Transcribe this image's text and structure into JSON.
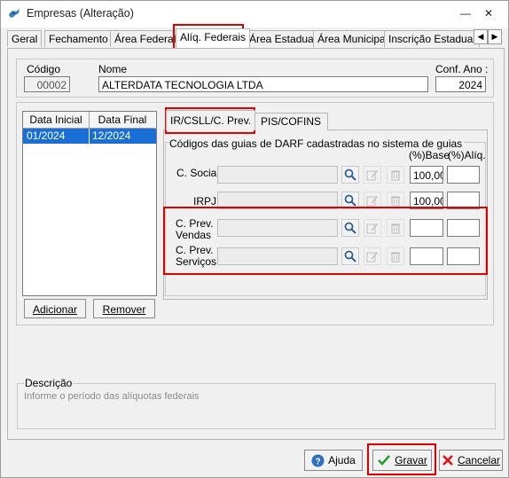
{
  "window": {
    "title": "Empresas (Alteração)",
    "minimize": "—",
    "close": "✕"
  },
  "tabs": [
    "Geral",
    "Fechamento",
    "Área Federal",
    "Alíq. Federais",
    "Área Estadual",
    "Área Municipal",
    "Inscrição Estadual S"
  ],
  "selected_tab": "Alíq. Federais",
  "header": {
    "codigo_label": "Código",
    "codigo_value": "00002",
    "nome_label": "Nome",
    "nome_value": "ALTERDATA TECNOLOGIA LTDA",
    "ano_label": "Conf. Ano :",
    "ano_value": "2024"
  },
  "periods": {
    "col_inicial": "Data Inicial",
    "col_final": "Data Final",
    "rows": [
      {
        "inicial": "01/2024",
        "final": "12/2024"
      }
    ]
  },
  "subtabs": [
    "IR/CSLL/C. Prev.",
    "PIS/COFINS"
  ],
  "selected_subtab": "IR/CSLL/C. Prev.",
  "darf": {
    "group_label": "Códigos das guias de DARF cadastradas no sistema de guias",
    "base_header": "(%)Base",
    "aliq_header": "(%)Alíq.",
    "rows": [
      {
        "label": "C. Social",
        "code": "",
        "base": "100,00",
        "aliq": ""
      },
      {
        "label": "IRPJ",
        "code": "",
        "base": "100,00",
        "aliq": ""
      },
      {
        "label_l1": "C. Prev.",
        "label_l2": "Vendas",
        "code": "",
        "base": "",
        "aliq": ""
      },
      {
        "label_l1": "C. Prev.",
        "label_l2": "Serviços",
        "code": "",
        "base": "",
        "aliq": ""
      }
    ]
  },
  "buttons": {
    "adicionar": "Adicionar",
    "remover": "Remover",
    "ajuda": "Ajuda",
    "gravar": "Gravar",
    "cancelar": "Cancelar"
  },
  "descricao": {
    "label": "Descrição",
    "text": "Informe o período das alíquotas federais"
  },
  "colors": {
    "highlight": "#e00000",
    "selection": "#1a6fd6"
  }
}
